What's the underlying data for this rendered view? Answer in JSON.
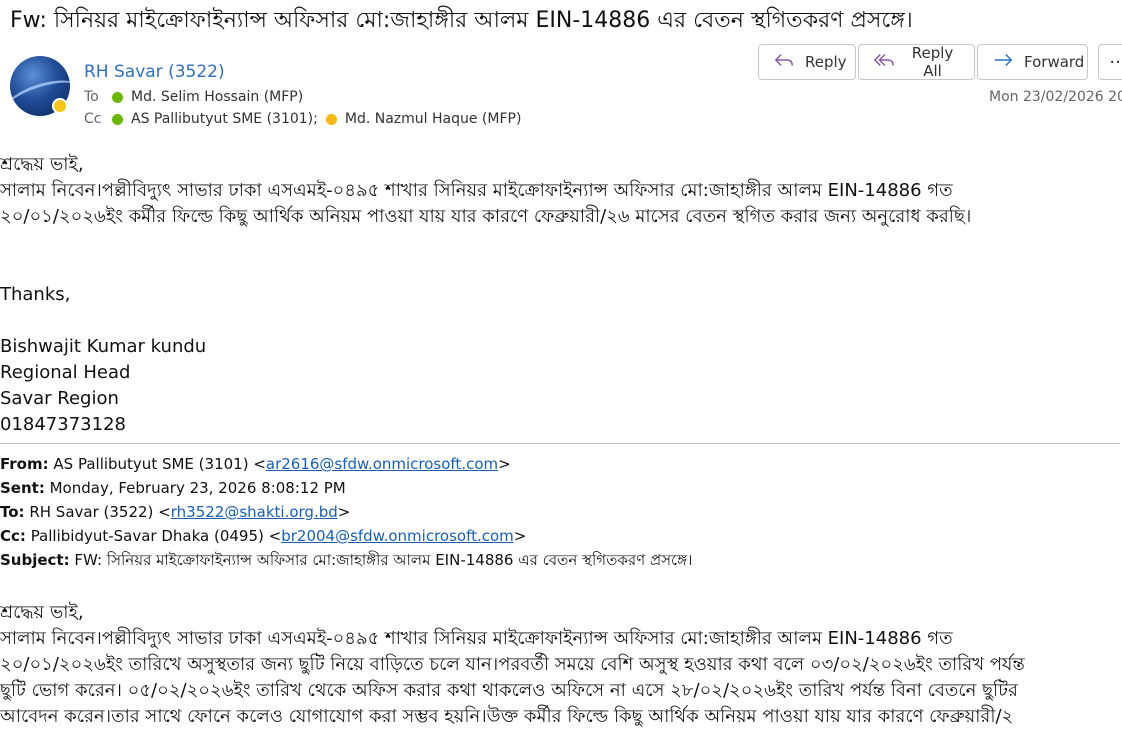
{
  "email": {
    "subject": "Fw:  সিনিয়র মাইক্রোফাইন্যান্স অফিসার মো:জাহাঙ্গীর আলম EIN-14886 এর বেতন স্থগিতকরণ প্রসঙ্গে।",
    "sender": "RH Savar (3522)",
    "to_label": "To",
    "to": [
      {
        "name": "Md. Selim Hossain (MFP)",
        "status": "green"
      }
    ],
    "cc_label": "Cc",
    "cc": [
      {
        "name": "AS Pallibutyut SME (3101);",
        "status": "green"
      },
      {
        "name": "Md. Nazmul Haque (MFP)",
        "status": "yellow"
      }
    ],
    "date": "Mon 23/02/2026 20:"
  },
  "toolbar": {
    "reply": "Reply",
    "reply_all": "Reply All",
    "forward": "Forward",
    "more": "···"
  },
  "body": {
    "greeting": "শ্রদ্ধেয় ভাই,",
    "line1": "সালাম নিবেন।পল্লীবিদ্যুৎ সাভার ঢাকা এসএমই-০৪৯৫ শাখার সিনিয়র মাইক্রোফাইন্যান্স অফিসার মো:জাহাঙ্গীর আলম EIN-14886 গত",
    "line2": "২০/০১/২০২৬ইং  কর্মীর ফিল্ডে কিছু আর্থিক অনিয়ম পাওয়া যায় যার কারণে ফেব্রুয়ারী/২৬ মাসের বেতন স্থগিত করার জন্য অনুরোধ করছি।",
    "thanks": "Thanks,",
    "sig_name": "Bishwajit Kumar kundu",
    "sig_title": "Regional Head",
    "sig_region": "Savar Region",
    "sig_phone": "01847373128"
  },
  "forwarded": {
    "from_label": "From:",
    "from_name": "AS Pallibutyut SME (3101) <",
    "from_email": "ar2616@sfdw.onmicrosoft.com",
    "sent_label": "Sent:",
    "sent": "Monday, February 23, 2026 8:08:12 PM",
    "to_label": "To:",
    "to_name": "RH Savar (3522) <",
    "to_email": "rh3522@shakti.org.bd",
    "cc_label": "Cc:",
    "cc_name": "Pallibidyut-Savar Dhaka (0495) <",
    "cc_email": "br2004@sfdw.onmicrosoft.com",
    "close": ">",
    "subject_label": "Subject:",
    "subject": "FW: সিনিয়র মাইক্রোফাইন্যান্স অফিসার মো:জাহাঙ্গীর আলম EIN-14886 এর বেতন স্থগিতকরণ প্রসঙ্গে।",
    "greeting": "শ্রদ্ধেয় ভাই,",
    "line1": "সালাম নিবেন।পল্লীবিদ্যুৎ সাভার ঢাকা এসএমই-০৪৯৫ শাখার সিনিয়র মাইক্রোফাইন্যান্স অফিসার মো:জাহাঙ্গীর আলম EIN-14886 গত",
    "line2": "২০/০১/২০২৬ইং তারিখে অসুস্থতার জন্য ছুটি নিয়ে বাড়িতে চলে যান।পরবর্তী সময়ে বেশি অসুস্থ হওয়ার কথা বলে ০৩/০২/২০২৬ইং তারিখ পর্যন্ত",
    "line3": "ছুটি ভোগ করেন। ০৫/০২/২০২৬ইং তারিখ থেকে অফিস করার কথা থাকলেও অফিসে না এসে ২৮/০২/২০২৬ইং তারিখ পর্যন্ত বিনা বেতনে ছুটির",
    "line4": "আবেদন করেন।তার সাথে ফোনে কলেও যোগাযোগ করা সম্ভব হয়নি।উক্ত কর্মীর ফিল্ডে কিছু আর্থিক অনিয়ম পাওয়া যায় যার কারণে ফেব্রুয়ারী/২"
  },
  "colors": {
    "link": "#1b5fb4",
    "sender": "#2f6fbf",
    "presence_available": "#6bb700",
    "presence_away": "#f5b90f"
  },
  "icons": [
    "reply-icon",
    "reply-all-icon",
    "forward-icon",
    "more-icon",
    "presence-icon"
  ]
}
